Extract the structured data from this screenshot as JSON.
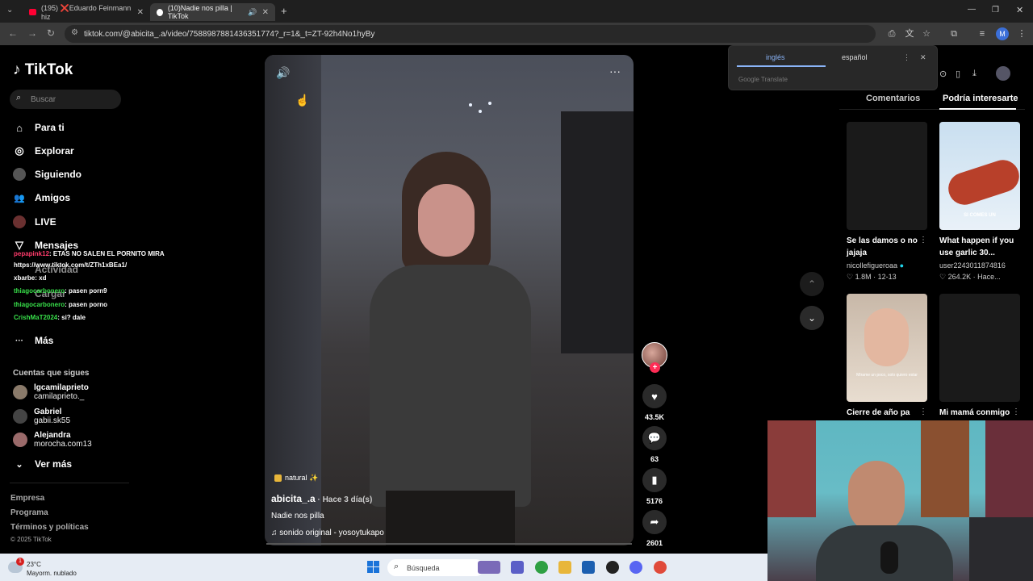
{
  "browser": {
    "tabs": [
      {
        "label": "(195) ❌Eduardo Feinmann hiz",
        "close": "✕"
      },
      {
        "label": "(10)Nadie nos pilla | TikTok",
        "close": "✕"
      }
    ],
    "new_tab": "+",
    "url": "tiktok.com/@abicita_.a/video/7588987881436351774?_r=1&_t=ZT-92h4No1hyBy",
    "profile_initial": "M",
    "window_controls": [
      "—",
      "❐",
      "✕"
    ]
  },
  "translate": {
    "source_lang": "inglés",
    "target_lang": "español",
    "footer": "Google Translate",
    "menu": "⋮",
    "close": "✕"
  },
  "sidebar": {
    "logo": "TikTok",
    "search_placeholder": "Buscar",
    "nav": [
      {
        "label": "Para ti",
        "icon": "home-icon",
        "glyph": "⌂"
      },
      {
        "label": "Explorar",
        "icon": "compass-icon",
        "glyph": "◎"
      },
      {
        "label": "Siguiendo",
        "icon": "following-icon",
        "glyph": "●"
      },
      {
        "label": "Amigos",
        "icon": "friends-icon",
        "glyph": "👥"
      },
      {
        "label": "LIVE",
        "icon": "live-icon",
        "glyph": "●"
      },
      {
        "label": "Mensajes",
        "icon": "messages-icon",
        "glyph": "▽"
      },
      {
        "label": "Actividad",
        "icon": "activity-icon",
        "glyph": ""
      },
      {
        "label": "Cargar",
        "icon": "upload-icon",
        "glyph": ""
      },
      {
        "label": "Más",
        "icon": "more-icon",
        "glyph": "···"
      }
    ],
    "following_title": "Cuentas que sigues",
    "following": [
      {
        "name": "lgcamilaprieto",
        "handle": "camilaprieto._"
      },
      {
        "name": "Gabriel",
        "handle": "gabii.sk55"
      },
      {
        "name": "Alejandra",
        "handle": "morocha.com13"
      }
    ],
    "see_more": "Ver más",
    "footer": [
      "Empresa",
      "Programa",
      "Términos y políticas",
      "© 2025 TikTok"
    ]
  },
  "chat_overlay": [
    {
      "user": "pepapink12",
      "msg": ": ETAS NO SALEN EL PORNITO MIRA",
      "color": "u1"
    },
    {
      "user": "",
      "msg": "https://www.tiktok.com/t/ZTh1xBEa1/",
      "color": "u3"
    },
    {
      "user": "xbarbe",
      "msg": ": xd",
      "color": "u3"
    },
    {
      "user": "thiagocarbonero",
      "msg": ": pasen porn9",
      "color": "u2"
    },
    {
      "user": "thiagocarbonero",
      "msg": ": pasen porno",
      "color": "u2"
    },
    {
      "user": "CrishMaT2024",
      "msg": ": si? dale",
      "color": "u2"
    }
  ],
  "video": {
    "tag": "natural ✨",
    "author": "abicita_.a",
    "age": " · Hace 3 día(s)",
    "caption": "Nadie nos pilla",
    "sound": "sonido original - yosoytukapo",
    "likes": "43.5K",
    "comments": "63",
    "saves": "5176",
    "shares": "2601"
  },
  "right_panel": {
    "tabs": [
      "Comentarios",
      "Podría interesarte"
    ],
    "cards": [
      {
        "title": "Se las damos o no jajaja",
        "user": "nicollefigueroaa",
        "likes": "♡ 1.8M",
        "date": "12-13"
      },
      {
        "title": "What happen if you use garlic 30...",
        "user": "user2243011874816",
        "likes": "♡ 264.2K",
        "date": "Hace..."
      },
      {
        "title": "Cierre de año pa",
        "user": "",
        "likes": "",
        "date": ""
      },
      {
        "title": "Mi mamá conmigo",
        "user": "",
        "likes": "",
        "date": ""
      }
    ],
    "thumb_caption": "SI COMES UN",
    "thumb_caption2": "Mírame un poco, solo quiero estar"
  },
  "taskbar": {
    "temp": "23°C",
    "weather": "Mayorm. nublado",
    "badge": "1",
    "search": "Búsqueda"
  }
}
